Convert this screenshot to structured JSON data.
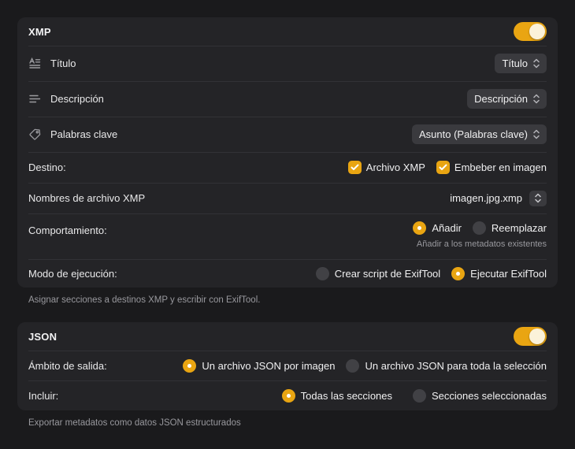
{
  "colors": {
    "accent": "#E9A512",
    "toggle_knob": "#FBF2D9",
    "page_bg": "#1a1a1c",
    "card_bg": "#242427",
    "separator": "#323236",
    "secondary_text": "#98989d",
    "control_bg": "#3a3a3e"
  },
  "icons": {
    "title": "textformat-icon",
    "description": "text-lines-icon",
    "keywords": "tag-icon",
    "dropdown": "chevron-up-down-icon",
    "checkbox": "checkmark-icon"
  },
  "xmp": {
    "title": "XMP",
    "toggle_on": true,
    "rows": [
      {
        "label": "Título",
        "value": "Título"
      },
      {
        "label": "Descripción",
        "value": "Descripción"
      },
      {
        "label": "Palabras clave",
        "value": "Asunto (Palabras clave)"
      }
    ],
    "destino": {
      "label": "Destino:",
      "checkboxes": [
        {
          "label": "Archivo XMP",
          "checked": true
        },
        {
          "label": "Embeber en imagen",
          "checked": true
        }
      ]
    },
    "filenames": {
      "label": "Nombres de archivo XMP",
      "value": "imagen.jpg.xmp"
    },
    "comportamiento": {
      "label": "Comportamiento:",
      "options": [
        {
          "label": "Añadir",
          "selected": true
        },
        {
          "label": "Reemplazar",
          "selected": false
        }
      ],
      "caption": "Añadir a los metadatos existentes"
    },
    "modo": {
      "label": "Modo de ejecución:",
      "options": [
        {
          "label": "Crear script de ExifTool",
          "selected": false
        },
        {
          "label": "Ejecutar ExifTool",
          "selected": true
        }
      ]
    },
    "footer": "Asignar secciones a destinos XMP y escribir con ExifTool."
  },
  "json": {
    "title": "JSON",
    "toggle_on": true,
    "ambito": {
      "label": "Ámbito de salida:",
      "options": [
        {
          "label": "Un archivo JSON por imagen",
          "selected": true
        },
        {
          "label": "Un archivo JSON para toda la selección",
          "selected": false
        }
      ]
    },
    "incluir": {
      "label": "Incluir:",
      "options": [
        {
          "label": "Todas las secciones",
          "selected": true
        },
        {
          "label": "Secciones seleccionadas",
          "selected": false
        }
      ]
    },
    "footer": "Exportar metadatos como datos JSON estructurados"
  }
}
